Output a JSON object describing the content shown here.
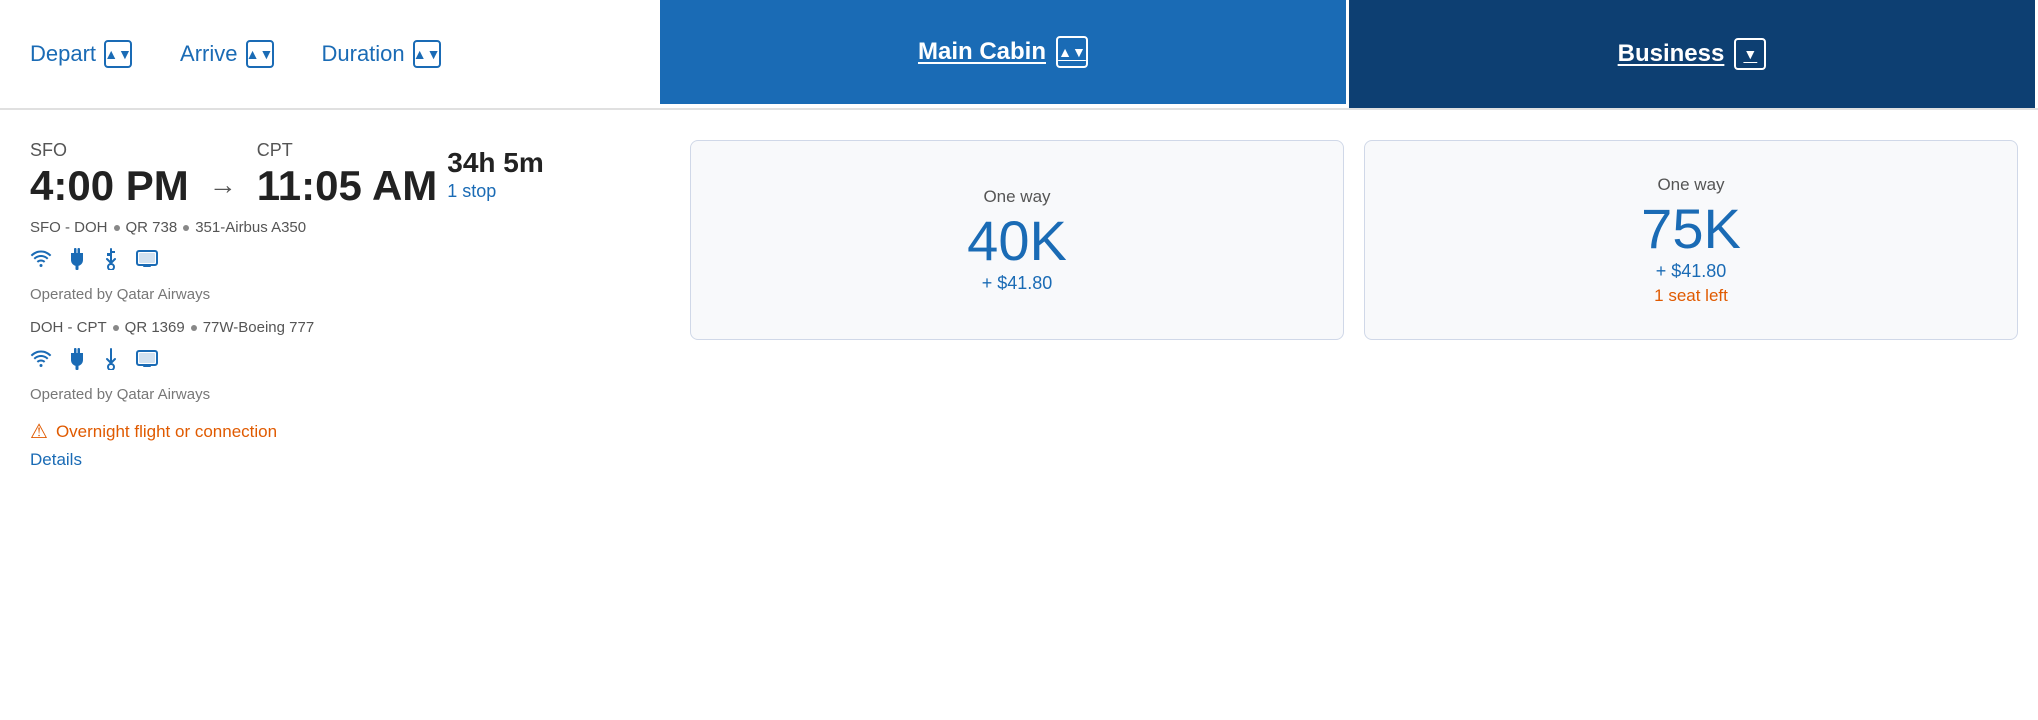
{
  "header": {
    "depart_label": "Depart",
    "arrive_label": "Arrive",
    "duration_label": "Duration",
    "main_cabin_label": "Main Cabin",
    "business_label": "Business"
  },
  "flight": {
    "depart_airport": "SFO",
    "depart_time": "4:00 PM",
    "arrive_airport": "CPT",
    "arrive_time": "11:05 AM",
    "duration": "34h 5m",
    "stops": "1 stop",
    "arrow": "→",
    "segment1": {
      "route": "SFO - DOH",
      "flight_number": "QR 738",
      "aircraft": "351-Airbus A350",
      "operated_by": "Operated by Qatar Airways"
    },
    "segment2": {
      "route": "DOH - CPT",
      "flight_number": "QR 1369",
      "aircraft": "77W-Boeing 777",
      "operated_by": "Operated by Qatar Airways"
    },
    "overnight_warning": "Overnight flight or connection",
    "details_link": "Details"
  },
  "main_cabin": {
    "one_way_label": "One way",
    "miles": "40K",
    "cash": "+ $41.80"
  },
  "business": {
    "one_way_label": "One way",
    "miles": "75K",
    "cash": "+ $41.80",
    "seats_left": "1 seat left"
  },
  "icons": {
    "sort_up_down": "⬆⬇",
    "sort_up": "▲",
    "sort_down": "▼",
    "wifi": "📶",
    "power": "🔌",
    "usb": "⚡",
    "entertainment": "📺",
    "warning": "⚠"
  }
}
